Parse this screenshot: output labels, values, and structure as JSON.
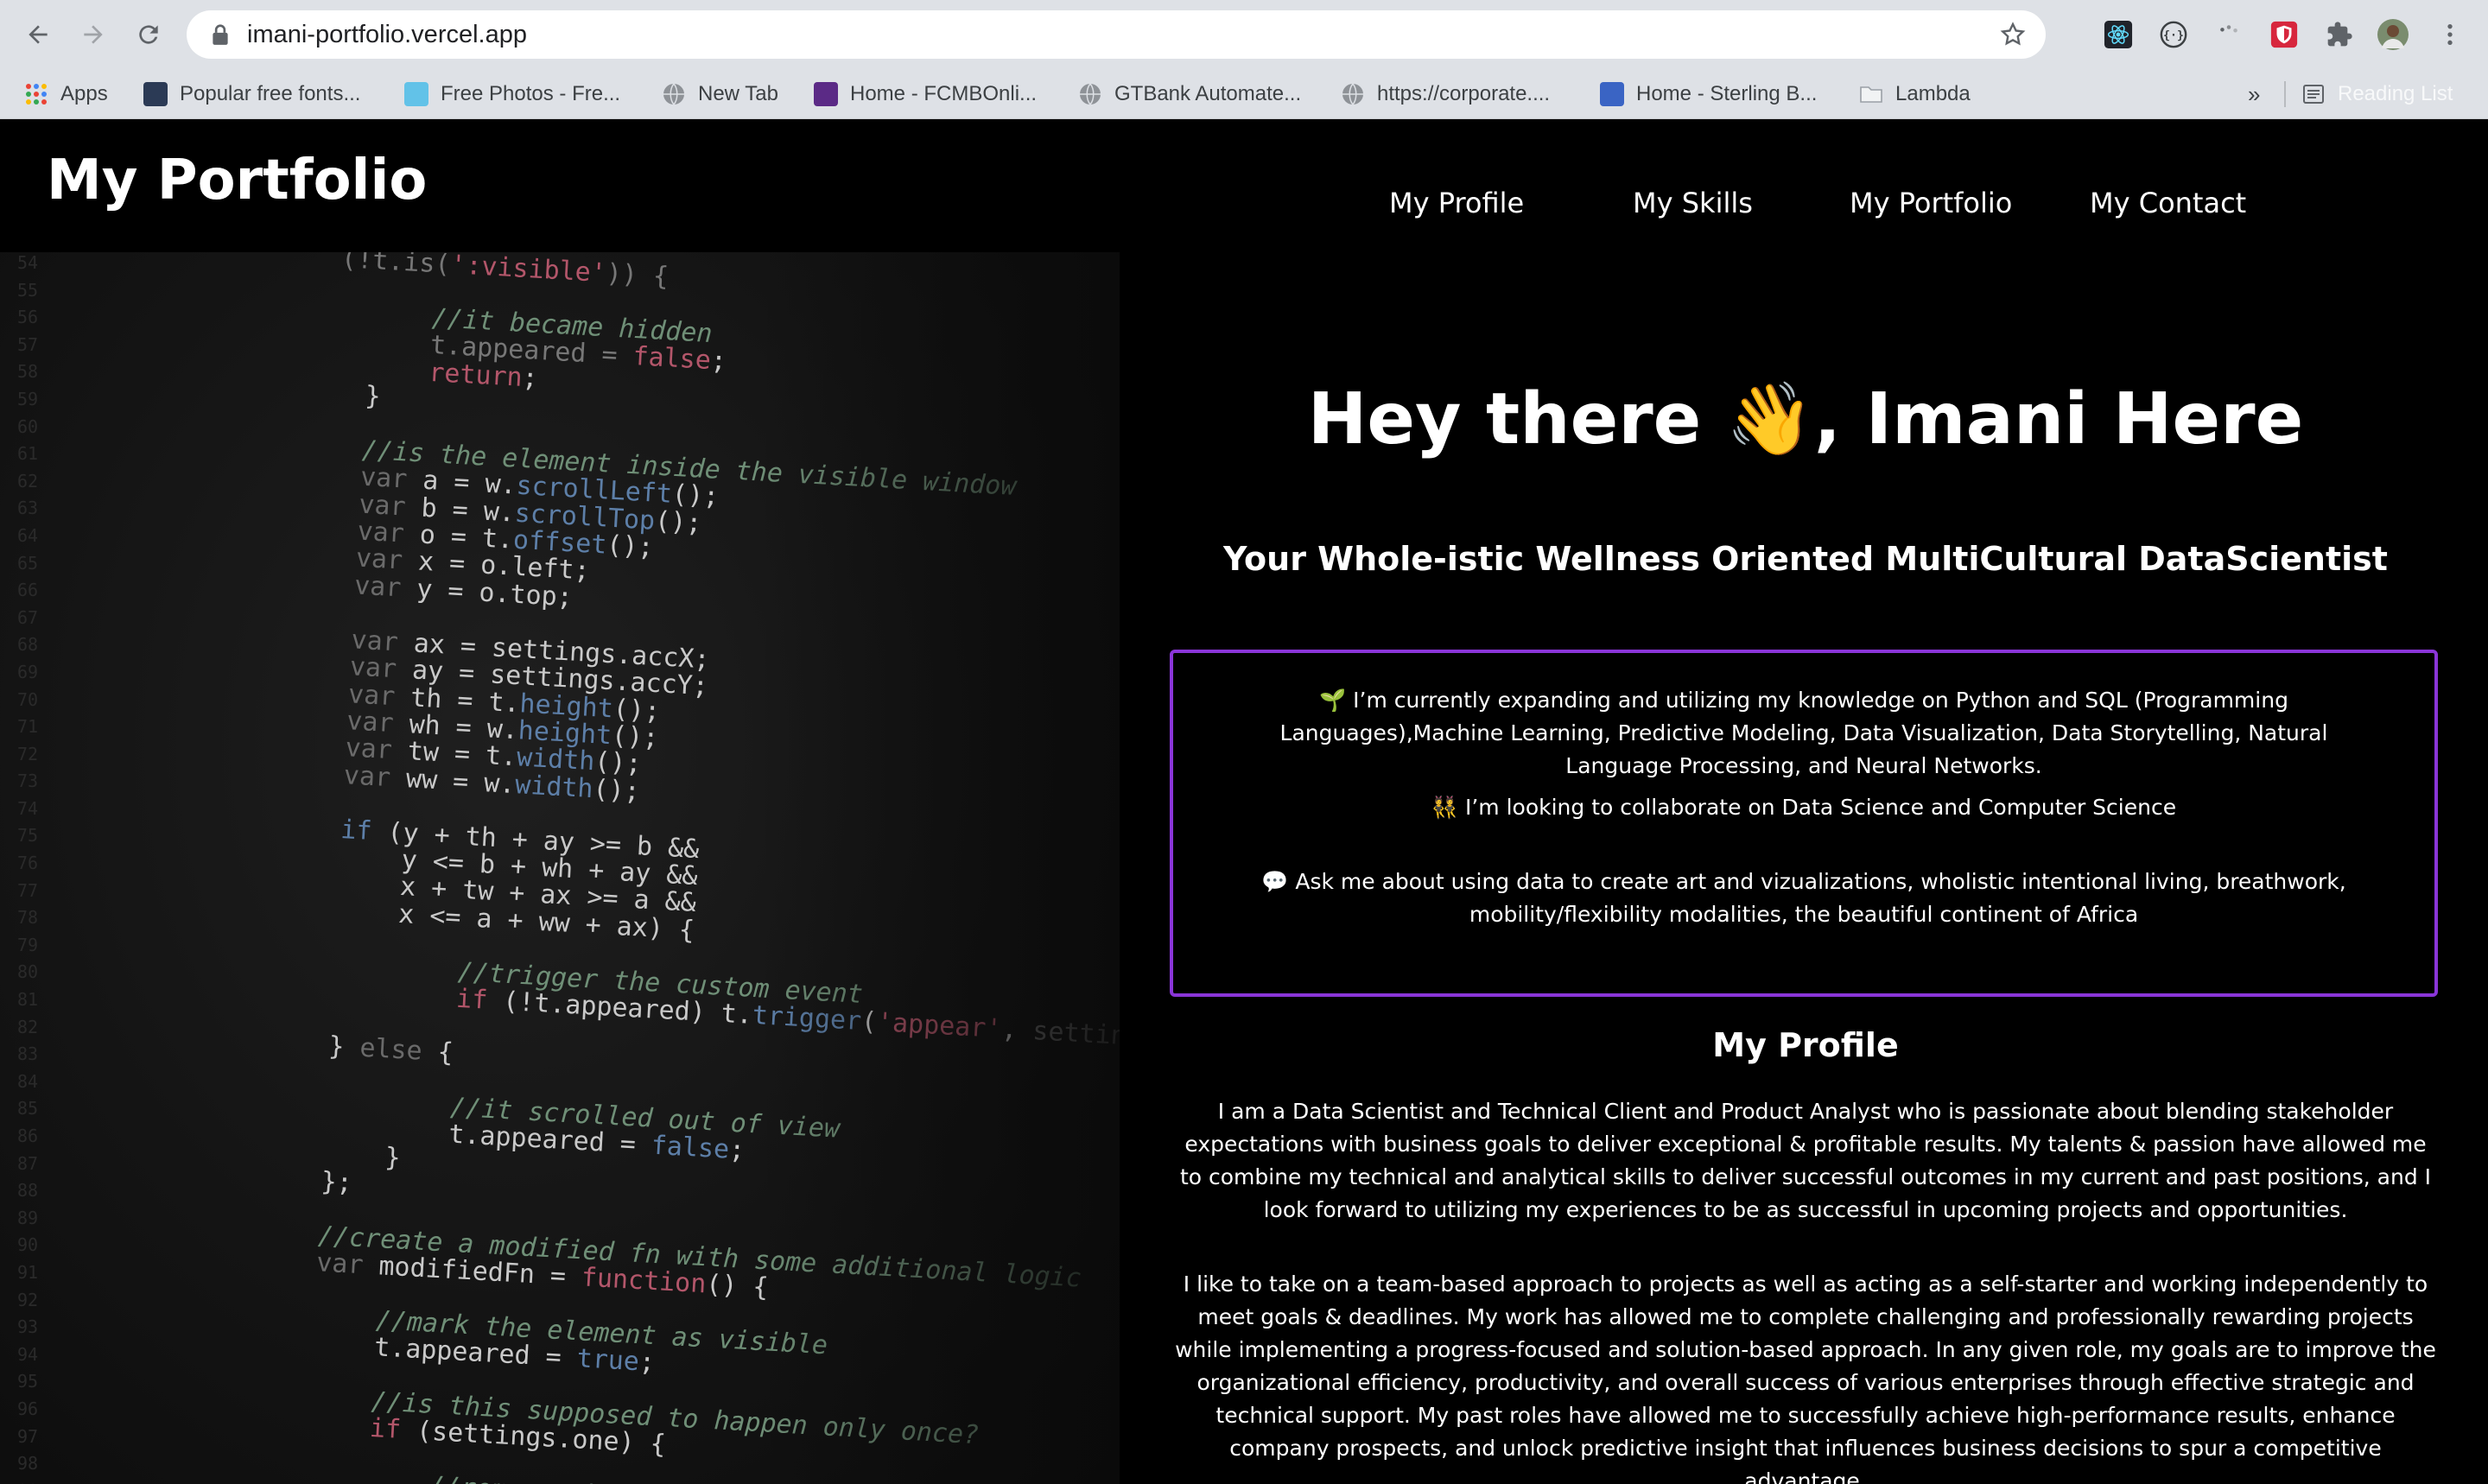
{
  "browser": {
    "url": "imani-portfolio.vercel.app",
    "bookmarks": [
      {
        "label": "Apps",
        "icon": "apps-grid-icon"
      },
      {
        "label": "Popular free fonts...",
        "icon": "fontsquirrel-favicon"
      },
      {
        "label": "Free Photos - Fre...",
        "icon": "pexels-favicon"
      },
      {
        "label": "New Tab",
        "icon": "globe-icon"
      },
      {
        "label": "Home - FCMBOnli...",
        "icon": "fcmb-favicon"
      },
      {
        "label": "GTBank Automate...",
        "icon": "globe-icon"
      },
      {
        "label": "https://corporate....",
        "icon": "globe-icon"
      },
      {
        "label": "Home - Sterling B...",
        "icon": "sterling-favicon"
      },
      {
        "label": "Lambda",
        "icon": "folder-icon"
      }
    ],
    "more": "»",
    "reading_list": "Reading List"
  },
  "site": {
    "logo": "My Portfolio",
    "nav": [
      "My Profile",
      "My Skills",
      "My Portfolio",
      "My Contact"
    ]
  },
  "hero": {
    "title": "Hey there 👋, Imani Here",
    "subtitle": "Your Whole-istic Wellness Oriented MultiCultural DataScientist"
  },
  "intro": {
    "line1": "🌱 I’m currently expanding and utilizing my knowledge on Python and SQL (Programming Languages),Machine Learning, Predictive Modeling, Data Visualization, Data Storytelling, Natural Language Processing, and Neural Networks.",
    "line2": "👯 I’m looking to collaborate on Data Science and Computer Science",
    "line3": "💬 Ask me about using data to create art and vizualizations, wholistic intentional living, breathwork, mobility/flexibility modalities, the beautiful continent of Africa"
  },
  "profile": {
    "title": "My Profile",
    "para1": "I am a Data Scientist and Technical Client and Product Analyst who is passionate about blending stakeholder expectations with business goals to deliver exceptional & profitable results. My talents & passion have allowed me to combine my technical and analytical skills to deliver successful outcomes in my current and past positions, and I look forward to utilizing my experiences to be as successful in upcoming projects and opportunities.",
    "para2": "I like to take on a team-based approach to projects as well as acting as a self-starter and working independently to meet goals & deadlines. My work has allowed me to complete challenging and professionally rewarding projects while implementing a progress-focused and solution-based approach. In any given role, my goals are to improve the organizational efficiency, productivity, and overall success of various enterprises through effective strategic and technical support. My past roles have allowed me to successfully achieve high-performance results, enhance company prospects, and unlock predictive insight that influences business decisions to spur a competitive advantage."
  },
  "colors": {
    "accent_border": "#8a35d8",
    "page_bg": "#000000",
    "chrome_bg": "#dee1e6"
  }
}
